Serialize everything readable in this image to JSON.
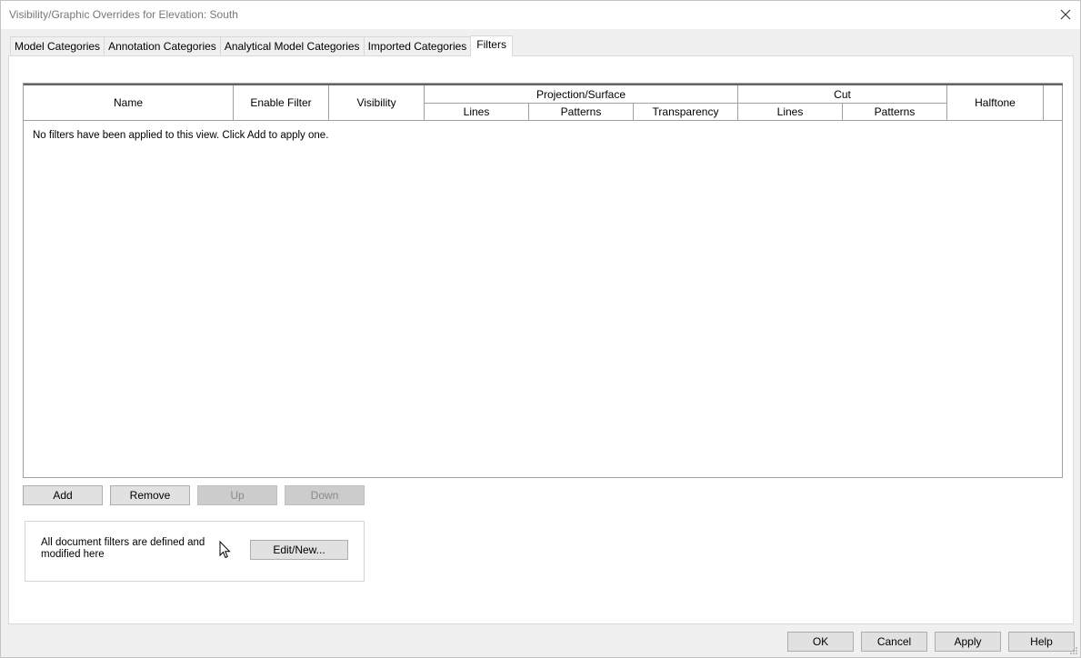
{
  "window": {
    "title": "Visibility/Graphic Overrides for Elevation: South"
  },
  "tabs": [
    {
      "label": "Model Categories",
      "active": false
    },
    {
      "label": "Annotation Categories",
      "active": false
    },
    {
      "label": "Analytical Model Categories",
      "active": false
    },
    {
      "label": "Imported Categories",
      "active": false
    },
    {
      "label": "Filters",
      "active": true
    }
  ],
  "grid": {
    "headers": {
      "name": "Name",
      "enable_filter": "Enable Filter",
      "visibility": "Visibility",
      "projection_surface": "Projection/Surface",
      "proj_lines": "Lines",
      "proj_patterns": "Patterns",
      "proj_transparency": "Transparency",
      "cut": "Cut",
      "cut_lines": "Lines",
      "cut_patterns": "Patterns",
      "halftone": "Halftone"
    },
    "empty_message": "No filters have been applied to this view. Click Add to apply one."
  },
  "row_buttons": {
    "add": "Add",
    "remove": "Remove",
    "up": "Up",
    "down": "Down"
  },
  "filter_group": {
    "description": "All document filters are defined and modified here",
    "edit_new": "Edit/New..."
  },
  "footer": {
    "ok": "OK",
    "cancel": "Cancel",
    "apply": "Apply",
    "help": "Help"
  },
  "icons": {
    "close": "close-icon",
    "cursor": "mouse-cursor-icon",
    "resize": "resize-grip-icon"
  }
}
